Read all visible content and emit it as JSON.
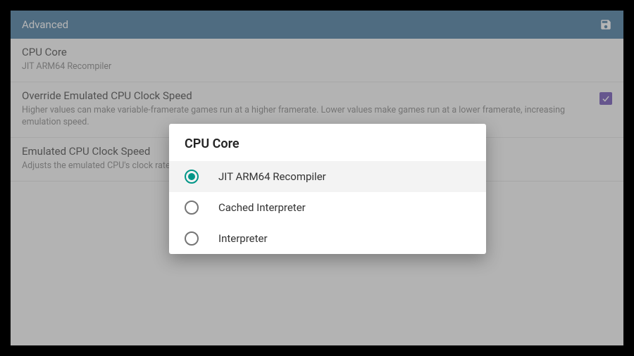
{
  "toolbar": {
    "title": "Advanced"
  },
  "settings": {
    "cpu_core": {
      "title": "CPU Core",
      "value": "JIT ARM64 Recompiler"
    },
    "override_clock": {
      "title": "Override Emulated CPU Clock Speed",
      "description": "Higher values can make variable-framerate games run at a higher framerate. Lower values make games run at a lower framerate, increasing emulation speed.",
      "checked": true
    },
    "clock_speed": {
      "title": "Emulated CPU Clock Speed",
      "description": "Adjusts the emulated CPU's clock rate."
    }
  },
  "dialog": {
    "title": "CPU Core",
    "options": [
      {
        "label": "JIT ARM64 Recompiler",
        "selected": true
      },
      {
        "label": "Cached Interpreter",
        "selected": false
      },
      {
        "label": "Interpreter",
        "selected": false
      }
    ]
  }
}
